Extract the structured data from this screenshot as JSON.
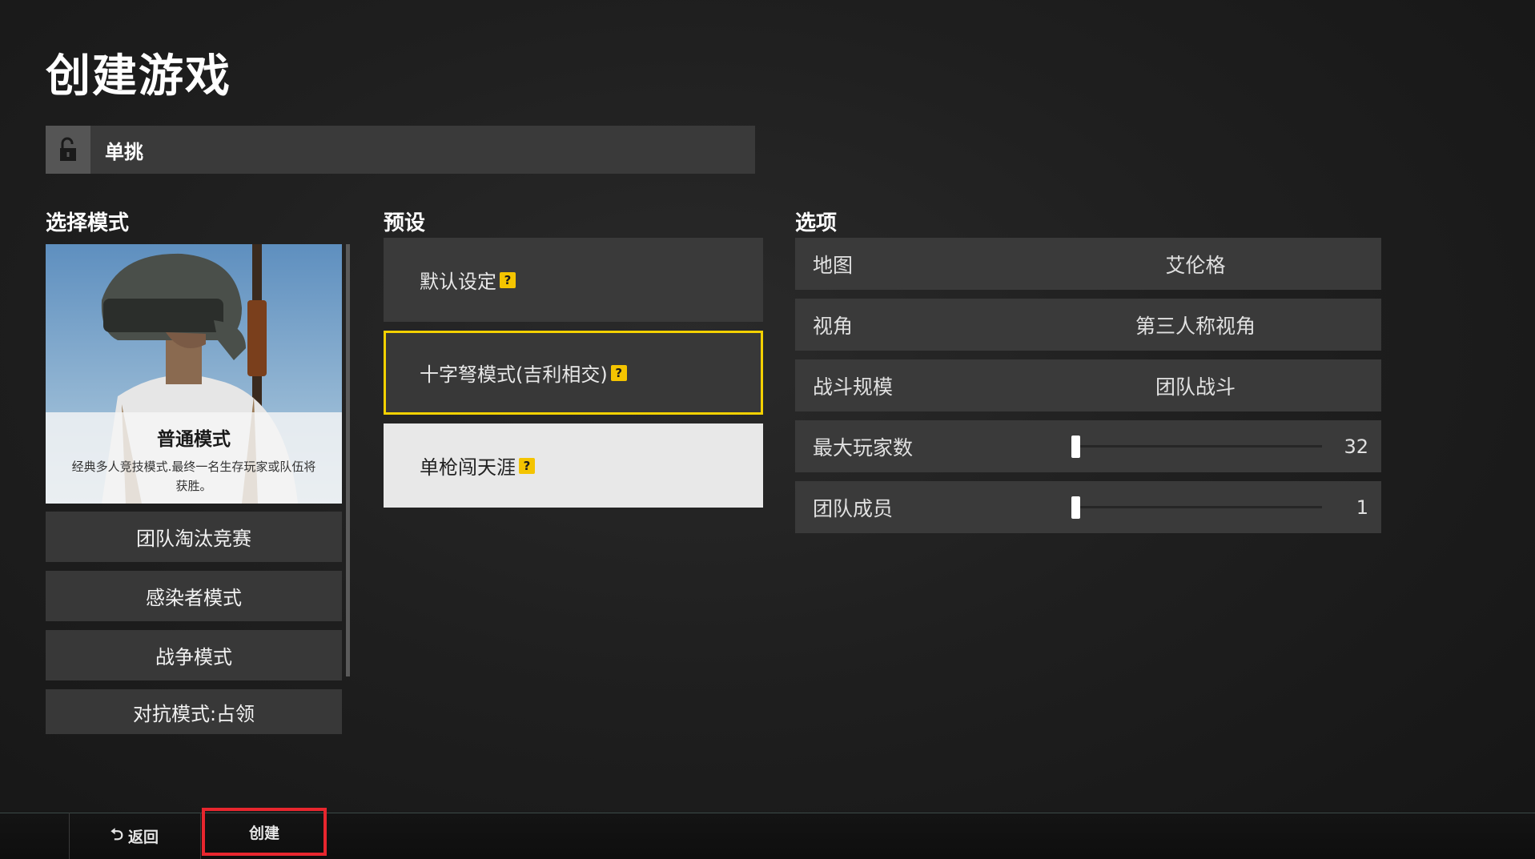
{
  "page": {
    "title": "创建游戏"
  },
  "room": {
    "name": "单挑",
    "lock_icon": "lock-open-icon"
  },
  "modes": {
    "section_title": "选择模式",
    "featured": {
      "title": "普通模式",
      "description": "经典多人竞技模式.最终一名生存玩家或队伍将获胜。"
    },
    "items": [
      {
        "label": "团队淘汰竞赛"
      },
      {
        "label": "感染者模式"
      },
      {
        "label": "战争模式"
      },
      {
        "label": "对抗模式:占领"
      }
    ]
  },
  "presets": {
    "section_title": "预设",
    "items": [
      {
        "label": "默认设定",
        "help": "?"
      },
      {
        "label": "十字弩模式(吉利相交)",
        "help": "?"
      },
      {
        "label": "单枪闯天涯",
        "help": "?"
      }
    ],
    "selected_index": 1
  },
  "options": {
    "section_title": "选项",
    "map": {
      "label": "地图",
      "value": "艾伦格"
    },
    "perspective": {
      "label": "视角",
      "value": "第三人称视角"
    },
    "battle_scale": {
      "label": "战斗规模",
      "value": "团队战斗"
    },
    "max_players": {
      "label": "最大玩家数",
      "value": "32"
    },
    "team_members": {
      "label": "团队成员",
      "value": "1"
    }
  },
  "footer": {
    "back_label": "返回",
    "back_icon": "undo-arrow-icon",
    "create_label": "创建"
  },
  "colors": {
    "accent_yellow": "#f4d100",
    "highlight_red": "#e8262e",
    "panel": "#3a3a3a"
  }
}
